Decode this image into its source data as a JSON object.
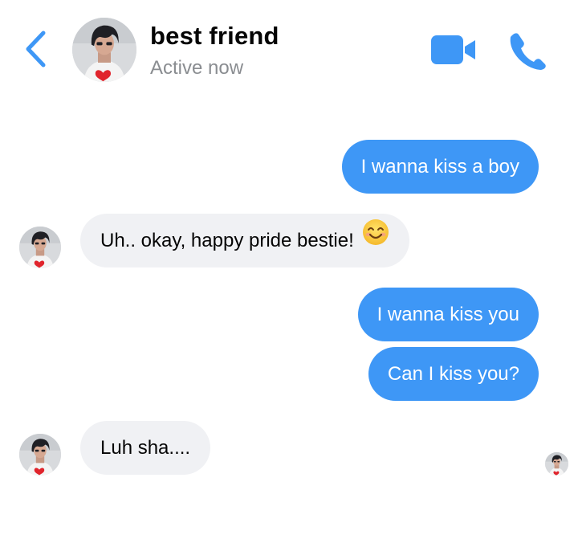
{
  "header": {
    "contact_name": "best friend",
    "status": "Active now",
    "back_icon": "chevron-left-icon",
    "video_icon": "video-camera-icon",
    "call_icon": "phone-icon"
  },
  "colors": {
    "accent": "#3e97f6",
    "incoming_bubble": "#f0f1f4",
    "status_text": "#8a8d91"
  },
  "messages": [
    {
      "side": "outgoing",
      "text": "I wanna kiss a boy"
    },
    {
      "side": "incoming",
      "text": "Uh.. okay, happy pride bestie!",
      "emoji": "smiling-face-icon"
    },
    {
      "side": "outgoing",
      "text": "I wanna kiss you"
    },
    {
      "side": "outgoing",
      "text": "Can I kiss you?"
    },
    {
      "side": "incoming",
      "text": "Luh sha...."
    }
  ]
}
